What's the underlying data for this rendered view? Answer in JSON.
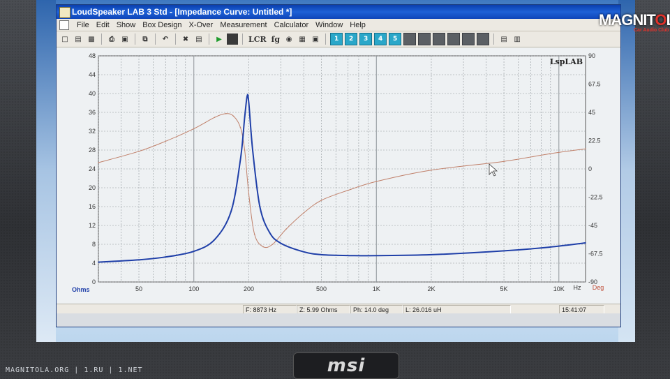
{
  "window": {
    "title": "LoudSpeaker LAB 3 Std - [Impedance Curve: Untitled *]"
  },
  "menu": {
    "items": [
      "File",
      "Edit",
      "Show",
      "Box Design",
      "X-Over",
      "Measurement",
      "Calculator",
      "Window",
      "Help"
    ]
  },
  "toolbar": {
    "text_buttons": [
      "LCR",
      "fg"
    ],
    "numbered_buttons": [
      "1",
      "2",
      "3",
      "4",
      "5"
    ]
  },
  "plot": {
    "brand": "LspLAB",
    "left_axis_unit": "Ohms",
    "right_axis_unit": "Deg",
    "x_unit": "Hz",
    "x_ticks": [
      "50",
      "100",
      "200",
      "500",
      "1K",
      "2K",
      "5K",
      "10K"
    ],
    "left_ticks": [
      "0",
      "4",
      "8",
      "12",
      "16",
      "20",
      "24",
      "28",
      "32",
      "36",
      "40",
      "44",
      "48"
    ],
    "right_ticks": [
      "-90",
      "-67.5",
      "-45",
      "-22.5",
      "0",
      "22.5",
      "45",
      "67.5",
      "90"
    ]
  },
  "status": {
    "freq": "F: 8873 Hz",
    "impedance": "Z: 5.99 Ohms",
    "phase": "Ph: 14.0 deg",
    "inductance": "L: 26.016 uH",
    "time": "15:41:07"
  },
  "watermarks": {
    "top_right_a": "MAGNIT",
    "top_right_o": "O",
    "top_right_b": "LA",
    "top_right_sub": "Car Audio Club",
    "bottom_left": "MAGNITOLA.ORG | 1.RU | 1.NET",
    "monitor_brand": "msi"
  },
  "colors": {
    "impedance_curve": "#1f3fa8",
    "phase_curve": "#c0806a",
    "grid": "#8e9499",
    "plot_bg": "#eef1f3"
  },
  "chart_data": {
    "type": "line",
    "xscale": "log",
    "xlim": [
      30,
      14000
    ],
    "ylim_left": [
      0,
      48
    ],
    "ylim_right": [
      -90,
      90
    ],
    "series": [
      {
        "axis": "left",
        "x": [
          30,
          50,
          70,
          100,
          130,
          160,
          180,
          190,
          196,
          200,
          210,
          230,
          260,
          300,
          400,
          500,
          700,
          1000,
          2000,
          5000,
          8873,
          14000
        ],
        "y": [
          4.2,
          4.7,
          5.3,
          6.5,
          9,
          15,
          26,
          35,
          39.5,
          38,
          28,
          16,
          10.5,
          8.2,
          6.4,
          5.8,
          5.6,
          5.6,
          5.8,
          6.6,
          7.4,
          8.3
        ]
      },
      {
        "axis": "right",
        "x": [
          30,
          50,
          70,
          100,
          130,
          150,
          165,
          180,
          190,
          200,
          215,
          240,
          270,
          320,
          400,
          500,
          700,
          1000,
          2000,
          5000,
          8873,
          14000
        ],
        "y": [
          5,
          14,
          22,
          32,
          41,
          44,
          42,
          33,
          15,
          -20,
          -52,
          -62,
          -60,
          -48,
          -35,
          -25,
          -17,
          -10,
          -1,
          6,
          12,
          16
        ]
      }
    ]
  }
}
